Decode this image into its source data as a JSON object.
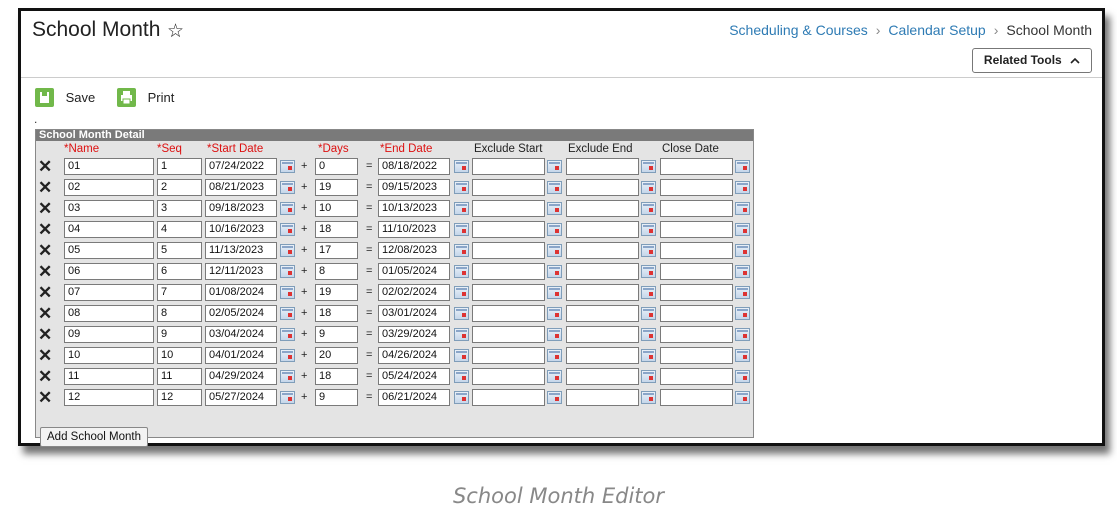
{
  "page": {
    "title": "School Month"
  },
  "breadcrumb": {
    "item1": "Scheduling & Courses",
    "item2": "Calendar Setup",
    "current": "School Month"
  },
  "related_tools": {
    "label": "Related Tools"
  },
  "toolbar": {
    "save_label": "Save",
    "print_label": "Print"
  },
  "detail": {
    "title": "School Month Detail",
    "headers": {
      "name": "*Name",
      "seq": "*Seq",
      "start": "*Start Date",
      "days": "*Days",
      "end": "*End Date",
      "exclude_start": "Exclude Start",
      "exclude_end": "Exclude End",
      "close": "Close Date"
    },
    "rows": [
      {
        "name": "01",
        "seq": "1",
        "start": "07/24/2022",
        "days": "0",
        "end": "08/18/2022"
      },
      {
        "name": "02",
        "seq": "2",
        "start": "08/21/2023",
        "days": "19",
        "end": "09/15/2023"
      },
      {
        "name": "03",
        "seq": "3",
        "start": "09/18/2023",
        "days": "10",
        "end": "10/13/2023"
      },
      {
        "name": "04",
        "seq": "4",
        "start": "10/16/2023",
        "days": "18",
        "end": "11/10/2023"
      },
      {
        "name": "05",
        "seq": "5",
        "start": "11/13/2023",
        "days": "17",
        "end": "12/08/2023"
      },
      {
        "name": "06",
        "seq": "6",
        "start": "12/11/2023",
        "days": "8",
        "end": "01/05/2024"
      },
      {
        "name": "07",
        "seq": "7",
        "start": "01/08/2024",
        "days": "19",
        "end": "02/02/2024"
      },
      {
        "name": "08",
        "seq": "8",
        "start": "02/05/2024",
        "days": "18",
        "end": "03/01/2024"
      },
      {
        "name": "09",
        "seq": "9",
        "start": "03/04/2024",
        "days": "9",
        "end": "03/29/2024"
      },
      {
        "name": "10",
        "seq": "10",
        "start": "04/01/2024",
        "days": "20",
        "end": "04/26/2024"
      },
      {
        "name": "11",
        "seq": "11",
        "start": "04/29/2024",
        "days": "18",
        "end": "05/24/2024"
      },
      {
        "name": "12",
        "seq": "12",
        "start": "05/27/2024",
        "days": "9",
        "end": "06/21/2024"
      }
    ],
    "add_label": "Add School Month"
  },
  "caption": "School Month Editor",
  "colors": {
    "link": "#2e7bb4",
    "required": "#dd1111",
    "toolbar_icon": "#71b84a",
    "panel_header": "#7a7a7a"
  },
  "icons": {
    "favorite": "star-icon",
    "delete": "delete-x-icon",
    "calendar": "calendar-icon",
    "save": "save-icon",
    "print": "print-icon",
    "related_tools": "chevron-up-icon"
  }
}
